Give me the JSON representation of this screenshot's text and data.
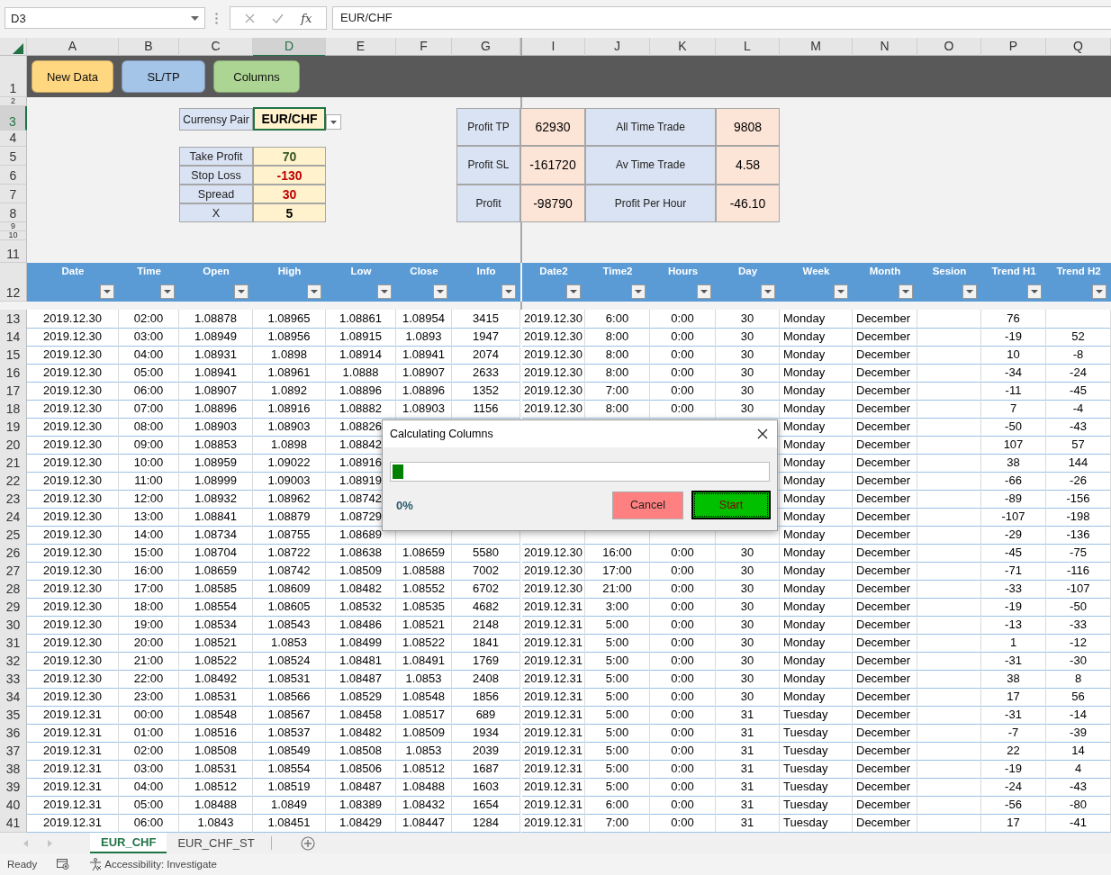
{
  "name_box": {
    "value": "D3"
  },
  "formula_bar": {
    "fx_label": "fx",
    "value": "EUR/CHF"
  },
  "column_letters": [
    {
      "label": "A",
      "selected": false
    },
    {
      "label": "B",
      "selected": false
    },
    {
      "label": "C",
      "selected": false
    },
    {
      "label": "D",
      "selected": true
    },
    {
      "label": "E",
      "selected": false
    },
    {
      "label": "F",
      "selected": false
    },
    {
      "label": "G",
      "selected": false
    },
    {
      "label": "I",
      "selected": false
    },
    {
      "label": "J",
      "selected": false
    },
    {
      "label": "K",
      "selected": false
    },
    {
      "label": "L",
      "selected": false
    },
    {
      "label": "M",
      "selected": false
    },
    {
      "label": "N",
      "selected": false
    },
    {
      "label": "O",
      "selected": false
    },
    {
      "label": "P",
      "selected": false
    },
    {
      "label": "Q",
      "selected": false
    }
  ],
  "top_rows": [
    {
      "label": "1",
      "selected": false
    },
    {
      "label": "2",
      "selected": false
    },
    {
      "label": "3",
      "selected": true
    },
    {
      "label": "4",
      "selected": false
    },
    {
      "label": "5",
      "selected": false
    },
    {
      "label": "6",
      "selected": false
    },
    {
      "label": "7",
      "selected": false
    },
    {
      "label": "8",
      "selected": false
    },
    {
      "label": "9",
      "selected": false
    },
    {
      "label": "10",
      "selected": false
    },
    {
      "label": "11",
      "selected": false
    }
  ],
  "macro_buttons": [
    {
      "label": "New Data",
      "color": "#ffd780"
    },
    {
      "label": "SL/TP",
      "color": "#a4c4e8"
    },
    {
      "label": "Columns",
      "color": "#acd492"
    }
  ],
  "currency_pair": {
    "label": "Currensy Pair",
    "value": "EUR/CHF"
  },
  "parameters": [
    {
      "label": "Take Profit",
      "value": "70",
      "color": "#375623"
    },
    {
      "label": "Stop Loss",
      "value": "-130",
      "color": "#c00000"
    },
    {
      "label": "Spread",
      "value": "30",
      "color": "#c00000"
    },
    {
      "label": "X",
      "value": "5",
      "color": "#000000"
    }
  ],
  "stats": [
    {
      "label": "Profit TP",
      "value": "62930"
    },
    {
      "label": "All Time Trade",
      "value": "9808"
    },
    {
      "label": "Profit SL",
      "value": "-161720"
    },
    {
      "label": "Av Time Trade",
      "value": "4.58"
    },
    {
      "label": "Profit",
      "value": "-98790"
    },
    {
      "label": "Profit Per Hour",
      "value": "-46.10"
    }
  ],
  "table": {
    "header_row": "12",
    "columns": [
      "Date",
      "Time",
      "Open",
      "High",
      "Low",
      "Close",
      "Info",
      "Date2",
      "Time2",
      "Hours",
      "Day",
      "Week",
      "Month",
      "Sesion",
      "Trend H1",
      "Trend H2"
    ],
    "rows": [
      {
        "row": "13",
        "cells": [
          "2019.12.30",
          "02:00",
          "1.08878",
          "1.08965",
          "1.08861",
          "1.08954",
          "3415",
          "2019.12.30",
          "6:00",
          "0:00",
          "30",
          "Monday",
          "December",
          null,
          "76",
          null
        ]
      },
      {
        "row": "14",
        "cells": [
          "2019.12.30",
          "03:00",
          "1.08949",
          "1.08956",
          "1.08915",
          "1.0893",
          "1947",
          "2019.12.30",
          "8:00",
          "0:00",
          "30",
          "Monday",
          "December",
          null,
          "-19",
          "52"
        ]
      },
      {
        "row": "15",
        "cells": [
          "2019.12.30",
          "04:00",
          "1.08931",
          "1.0898",
          "1.08914",
          "1.08941",
          "2074",
          "2019.12.30",
          "8:00",
          "0:00",
          "30",
          "Monday",
          "December",
          null,
          "10",
          "-8"
        ]
      },
      {
        "row": "16",
        "cells": [
          "2019.12.30",
          "05:00",
          "1.08941",
          "1.08961",
          "1.0888",
          "1.08907",
          "2633",
          "2019.12.30",
          "8:00",
          "0:00",
          "30",
          "Monday",
          "December",
          null,
          "-34",
          "-24"
        ]
      },
      {
        "row": "17",
        "cells": [
          "2019.12.30",
          "06:00",
          "1.08907",
          "1.0892",
          "1.08896",
          "1.08896",
          "1352",
          "2019.12.30",
          "7:00",
          "0:00",
          "30",
          "Monday",
          "December",
          null,
          "-11",
          "-45"
        ]
      },
      {
        "row": "18",
        "cells": [
          "2019.12.30",
          "07:00",
          "1.08896",
          "1.08916",
          "1.08882",
          "1.08903",
          "1156",
          "2019.12.30",
          "8:00",
          "0:00",
          "30",
          "Monday",
          "December",
          null,
          "7",
          "-4"
        ]
      },
      {
        "row": "19",
        "cells": [
          "2019.12.30",
          "08:00",
          "1.08903",
          "1.08903",
          "1.08826",
          null,
          null,
          null,
          null,
          null,
          null,
          "Monday",
          "December",
          null,
          "-50",
          "-43"
        ]
      },
      {
        "row": "20",
        "cells": [
          "2019.12.30",
          "09:00",
          "1.08853",
          "1.0898",
          "1.08842",
          null,
          null,
          null,
          null,
          null,
          null,
          "Monday",
          "December",
          null,
          "107",
          "57"
        ]
      },
      {
        "row": "21",
        "cells": [
          "2019.12.30",
          "10:00",
          "1.08959",
          "1.09022",
          "1.08916",
          null,
          null,
          null,
          null,
          null,
          null,
          "Monday",
          "December",
          null,
          "38",
          "144"
        ]
      },
      {
        "row": "22",
        "cells": [
          "2019.12.30",
          "11:00",
          "1.08999",
          "1.09003",
          "1.08919",
          null,
          null,
          null,
          null,
          null,
          null,
          "Monday",
          "December",
          null,
          "-66",
          "-26"
        ]
      },
      {
        "row": "23",
        "cells": [
          "2019.12.30",
          "12:00",
          "1.08932",
          "1.08962",
          "1.08742",
          null,
          null,
          null,
          null,
          null,
          null,
          "Monday",
          "December",
          null,
          "-89",
          "-156"
        ]
      },
      {
        "row": "24",
        "cells": [
          "2019.12.30",
          "13:00",
          "1.08841",
          "1.08879",
          "1.08729",
          null,
          null,
          null,
          null,
          null,
          null,
          "Monday",
          "December",
          null,
          "-107",
          "-198"
        ]
      },
      {
        "row": "25",
        "cells": [
          "2019.12.30",
          "14:00",
          "1.08734",
          "1.08755",
          "1.08689",
          null,
          null,
          null,
          null,
          null,
          null,
          "Monday",
          "December",
          null,
          "-29",
          "-136"
        ]
      },
      {
        "row": "26",
        "cells": [
          "2019.12.30",
          "15:00",
          "1.08704",
          "1.08722",
          "1.08638",
          "1.08659",
          "5580",
          "2019.12.30",
          "16:00",
          "0:00",
          "30",
          "Monday",
          "December",
          null,
          "-45",
          "-75"
        ]
      },
      {
        "row": "27",
        "cells": [
          "2019.12.30",
          "16:00",
          "1.08659",
          "1.08742",
          "1.08509",
          "1.08588",
          "7002",
          "2019.12.30",
          "17:00",
          "0:00",
          "30",
          "Monday",
          "December",
          null,
          "-71",
          "-116"
        ]
      },
      {
        "row": "28",
        "cells": [
          "2019.12.30",
          "17:00",
          "1.08585",
          "1.08609",
          "1.08482",
          "1.08552",
          "6702",
          "2019.12.30",
          "21:00",
          "0:00",
          "30",
          "Monday",
          "December",
          null,
          "-33",
          "-107"
        ]
      },
      {
        "row": "29",
        "cells": [
          "2019.12.30",
          "18:00",
          "1.08554",
          "1.08605",
          "1.08532",
          "1.08535",
          "4682",
          "2019.12.31",
          "3:00",
          "0:00",
          "30",
          "Monday",
          "December",
          null,
          "-19",
          "-50"
        ]
      },
      {
        "row": "30",
        "cells": [
          "2019.12.30",
          "19:00",
          "1.08534",
          "1.08543",
          "1.08486",
          "1.08521",
          "2148",
          "2019.12.31",
          "5:00",
          "0:00",
          "30",
          "Monday",
          "December",
          null,
          "-13",
          "-33"
        ]
      },
      {
        "row": "31",
        "cells": [
          "2019.12.30",
          "20:00",
          "1.08521",
          "1.0853",
          "1.08499",
          "1.08522",
          "1841",
          "2019.12.31",
          "5:00",
          "0:00",
          "30",
          "Monday",
          "December",
          null,
          "1",
          "-12"
        ]
      },
      {
        "row": "32",
        "cells": [
          "2019.12.30",
          "21:00",
          "1.08522",
          "1.08524",
          "1.08481",
          "1.08491",
          "1769",
          "2019.12.31",
          "5:00",
          "0:00",
          "30",
          "Monday",
          "December",
          null,
          "-31",
          "-30"
        ]
      },
      {
        "row": "33",
        "cells": [
          "2019.12.30",
          "22:00",
          "1.08492",
          "1.08531",
          "1.08487",
          "1.0853",
          "2408",
          "2019.12.31",
          "5:00",
          "0:00",
          "30",
          "Monday",
          "December",
          null,
          "38",
          "8"
        ]
      },
      {
        "row": "34",
        "cells": [
          "2019.12.30",
          "23:00",
          "1.08531",
          "1.08566",
          "1.08529",
          "1.08548",
          "1856",
          "2019.12.31",
          "5:00",
          "0:00",
          "30",
          "Monday",
          "December",
          null,
          "17",
          "56"
        ]
      },
      {
        "row": "35",
        "cells": [
          "2019.12.31",
          "00:00",
          "1.08548",
          "1.08567",
          "1.08458",
          "1.08517",
          "689",
          "2019.12.31",
          "5:00",
          "0:00",
          "31",
          "Tuesday",
          "December",
          null,
          "-31",
          "-14"
        ]
      },
      {
        "row": "36",
        "cells": [
          "2019.12.31",
          "01:00",
          "1.08516",
          "1.08537",
          "1.08482",
          "1.08509",
          "1934",
          "2019.12.31",
          "5:00",
          "0:00",
          "31",
          "Tuesday",
          "December",
          null,
          "-7",
          "-39"
        ]
      },
      {
        "row": "37",
        "cells": [
          "2019.12.31",
          "02:00",
          "1.08508",
          "1.08549",
          "1.08508",
          "1.0853",
          "2039",
          "2019.12.31",
          "5:00",
          "0:00",
          "31",
          "Tuesday",
          "December",
          null,
          "22",
          "14"
        ]
      },
      {
        "row": "38",
        "cells": [
          "2019.12.31",
          "03:00",
          "1.08531",
          "1.08554",
          "1.08506",
          "1.08512",
          "1687",
          "2019.12.31",
          "5:00",
          "0:00",
          "31",
          "Tuesday",
          "December",
          null,
          "-19",
          "4"
        ]
      },
      {
        "row": "39",
        "cells": [
          "2019.12.31",
          "04:00",
          "1.08512",
          "1.08519",
          "1.08487",
          "1.08488",
          "1603",
          "2019.12.31",
          "5:00",
          "0:00",
          "31",
          "Tuesday",
          "December",
          null,
          "-24",
          "-43"
        ]
      },
      {
        "row": "40",
        "cells": [
          "2019.12.31",
          "05:00",
          "1.08488",
          "1.0849",
          "1.08389",
          "1.08432",
          "1654",
          "2019.12.31",
          "6:00",
          "0:00",
          "31",
          "Tuesday",
          "December",
          null,
          "-56",
          "-80"
        ]
      },
      {
        "row": "41",
        "cells": [
          "2019.12.31",
          "06:00",
          "1.0843",
          "1.08451",
          "1.08429",
          "1.08447",
          "1284",
          "2019.12.31",
          "7:00",
          "0:00",
          "31",
          "Tuesday",
          "December",
          null,
          "17",
          "-41"
        ]
      }
    ]
  },
  "dialog": {
    "title": "Calculating Columns",
    "level": 0.03,
    "percent": "0%",
    "buttons": [
      {
        "label": "Cancel",
        "kind": "cancel"
      },
      {
        "label": "Start",
        "kind": "start"
      }
    ]
  },
  "sheet_tabs": [
    {
      "label": "EUR_CHF",
      "selected": true
    },
    {
      "label": "EUR_CHF_ST",
      "selected": false
    }
  ],
  "status_bar": {
    "status": "Ready",
    "accessibility": "Accessibility: Investigate"
  }
}
